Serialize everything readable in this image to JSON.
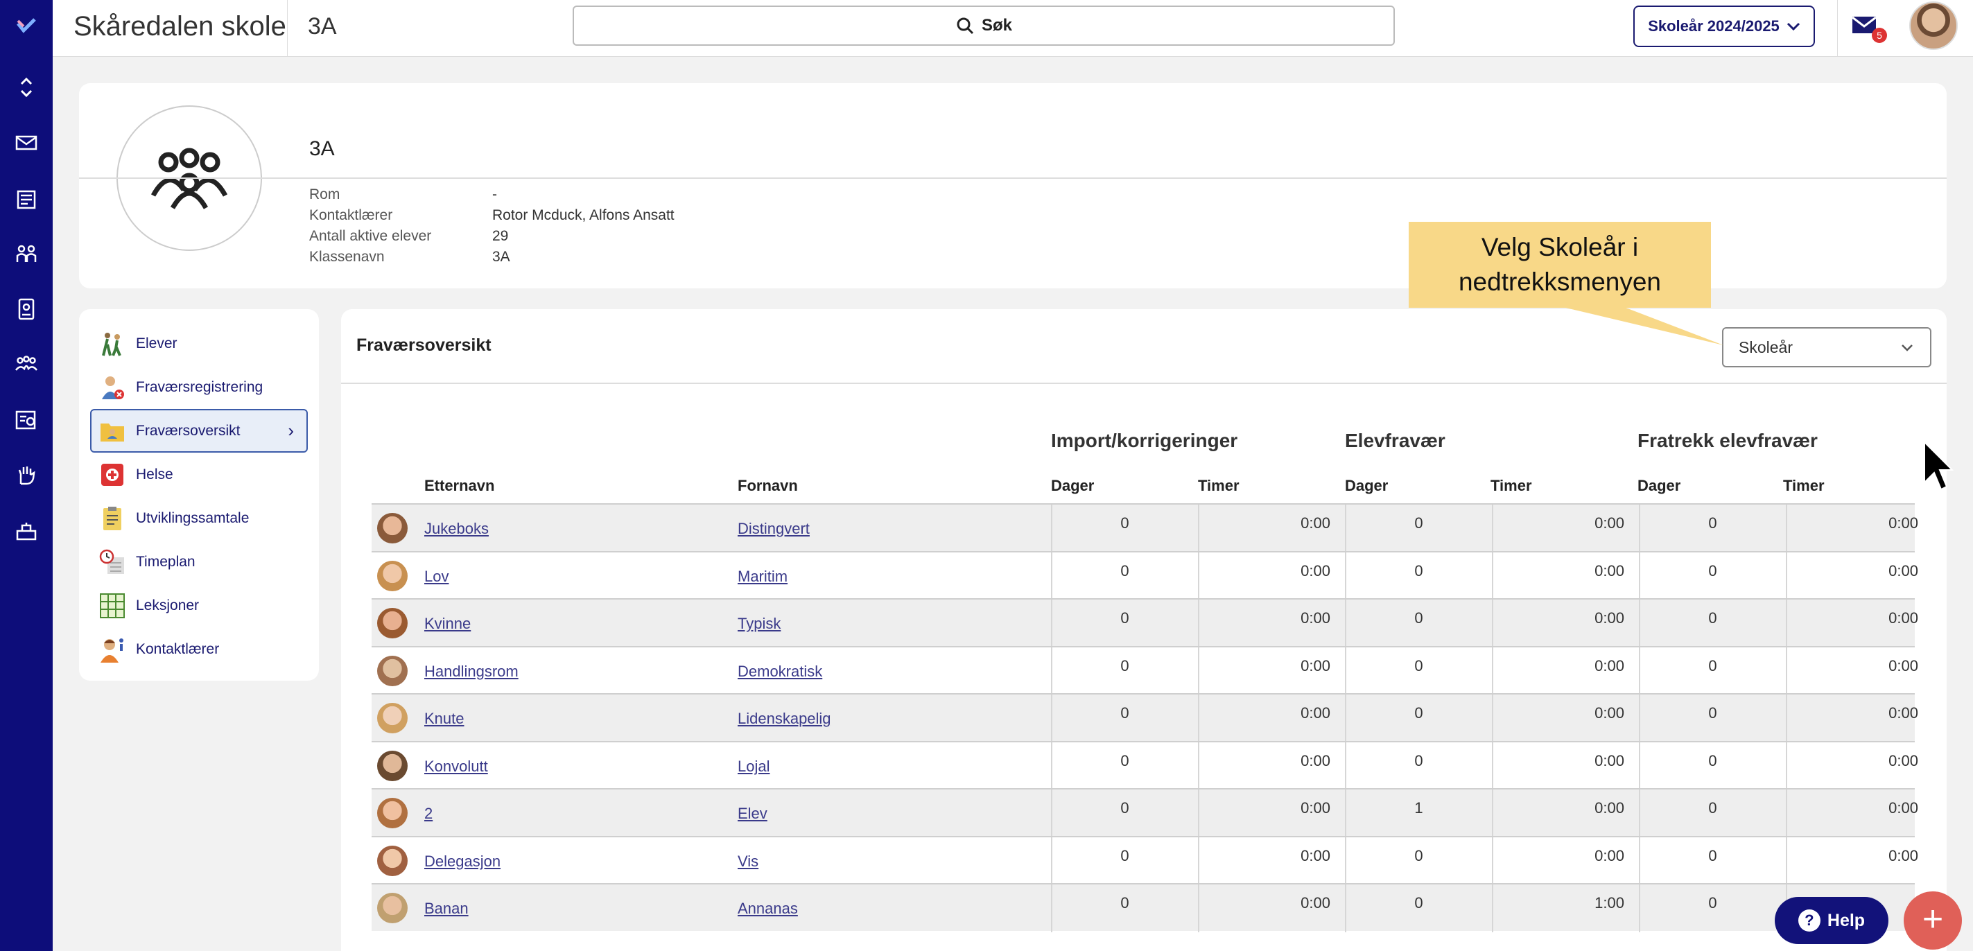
{
  "topbar": {
    "school_name": "Skåredalen skole",
    "class_name": "3A",
    "search_label": "Søk",
    "year_button": "Skoleår 2024/2025",
    "unread_count": "5"
  },
  "rail": {
    "icons": [
      "logo-icon",
      "expand-icon",
      "mail-icon",
      "news-icon",
      "students-icon",
      "badge-icon",
      "groups-icon",
      "exam-icon",
      "hand-icon",
      "desk-icon"
    ]
  },
  "header": {
    "title": "3A",
    "fields": [
      {
        "key": "Rom",
        "value": "-"
      },
      {
        "key": "Kontaktlærer",
        "value": "Rotor Mcduck, Alfons Ansatt"
      },
      {
        "key": "Antall aktive elever",
        "value": "29"
      },
      {
        "key": "Klassenavn",
        "value": "3A"
      }
    ]
  },
  "menu": {
    "items": [
      {
        "label": "Elever",
        "icon": "students-walking-icon"
      },
      {
        "label": "Fraværsregistrering",
        "icon": "absence-register-icon"
      },
      {
        "label": "Fraværsoversikt",
        "icon": "absence-folder-icon",
        "active": true
      },
      {
        "label": "Helse",
        "icon": "health-icon"
      },
      {
        "label": "Utviklingssamtale",
        "icon": "clipboard-icon"
      },
      {
        "label": "Timeplan",
        "icon": "schedule-icon"
      },
      {
        "label": "Leksjoner",
        "icon": "grid-icon"
      },
      {
        "label": "Kontaktlærer",
        "icon": "teacher-icon"
      }
    ]
  },
  "main": {
    "title": "Fraværsoversikt",
    "select_value": "Skoleår",
    "callout": "Velg Skoleår i nedtrekksmenyen",
    "groups": [
      "Import/korrigeringer",
      "Elevfravær",
      "Fratrekk elevfravær"
    ],
    "columns": {
      "lastname": "Etternavn",
      "firstname": "Fornavn",
      "days": "Dager",
      "hours": "Timer"
    },
    "rows": [
      {
        "last": "Jukeboks",
        "first": "Distingvert",
        "v": [
          "0",
          "0:00",
          "0",
          "0:00",
          "0",
          "0:00"
        ]
      },
      {
        "last": "Lov",
        "first": "Maritim",
        "v": [
          "0",
          "0:00",
          "0",
          "0:00",
          "0",
          "0:00"
        ]
      },
      {
        "last": "Kvinne",
        "first": "Typisk",
        "v": [
          "0",
          "0:00",
          "0",
          "0:00",
          "0",
          "0:00"
        ]
      },
      {
        "last": "Handlingsrom",
        "first": "Demokratisk",
        "v": [
          "0",
          "0:00",
          "0",
          "0:00",
          "0",
          "0:00"
        ]
      },
      {
        "last": "Knute",
        "first": "Lidenskapelig",
        "v": [
          "0",
          "0:00",
          "0",
          "0:00",
          "0",
          "0:00"
        ]
      },
      {
        "last": "Konvolutt",
        "first": "Lojal",
        "v": [
          "0",
          "0:00",
          "0",
          "0:00",
          "0",
          "0:00"
        ]
      },
      {
        "last": "2",
        "first": "Elev",
        "v": [
          "0",
          "0:00",
          "1",
          "0:00",
          "0",
          "0:00"
        ]
      },
      {
        "last": "Delegasjon",
        "first": "Vis",
        "v": [
          "0",
          "0:00",
          "0",
          "0:00",
          "0",
          "0:00"
        ]
      },
      {
        "last": "Banan",
        "first": "Annanas",
        "v": [
          "0",
          "0:00",
          "0",
          "1:00",
          "0",
          ""
        ]
      }
    ]
  },
  "help_label": "Help",
  "colors": {
    "navy": "#0d0d7a",
    "callout": "#f8d888",
    "fab": "#e06058"
  }
}
